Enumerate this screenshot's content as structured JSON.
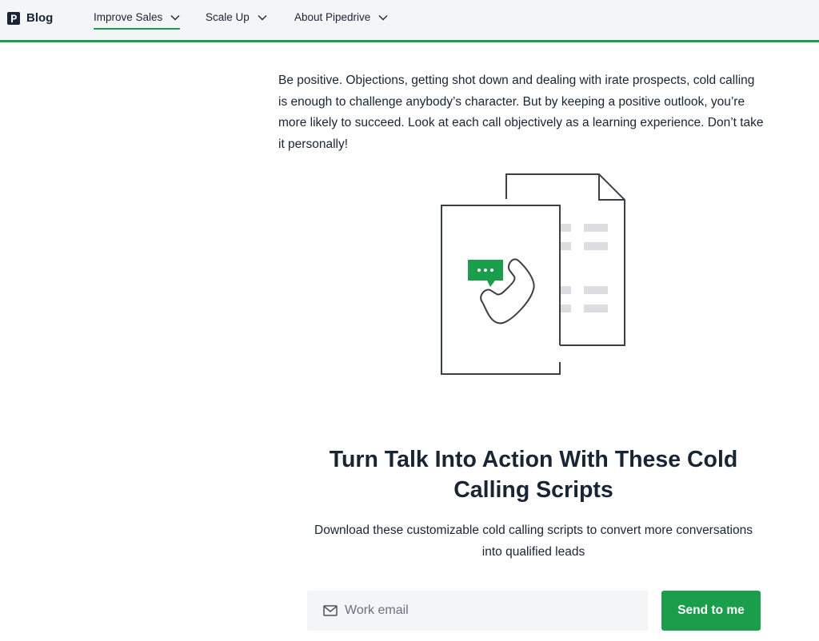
{
  "header": {
    "logo_text": "Blog",
    "nav": [
      {
        "label": "Improve Sales",
        "active": true
      },
      {
        "label": "Scale Up",
        "active": false
      },
      {
        "label": "About Pipedrive",
        "active": false
      }
    ],
    "accent_color": "#1b9e4c"
  },
  "article": {
    "paragraph": "Be positive. Objections, getting shot down and dealing with irate prospects, cold calling is enough to challenge anybody’s character. But by keeping a positive outlook, you’re more likely to succeed. Look at each call objectively as a learning experience. Don’t take it personally!",
    "illustration_icons": [
      "document-icon",
      "phone-icon",
      "chat-bubble-icon"
    ]
  },
  "cta": {
    "title": "Turn Talk Into Action With These Cold Calling Scripts",
    "description": "Download these customizable cold calling scripts to convert more conversations into qualified leads",
    "email_placeholder": "Work email",
    "button_label": "Send to me",
    "button_color": "#1b9e4c"
  }
}
